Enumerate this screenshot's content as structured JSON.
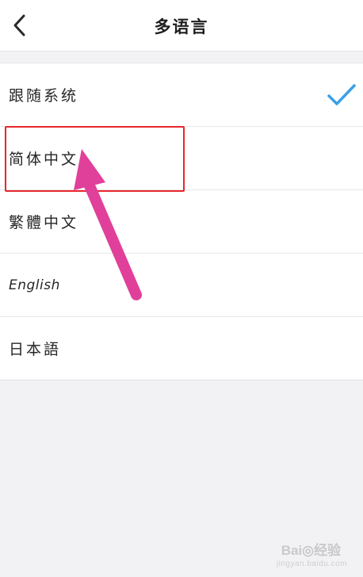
{
  "header": {
    "title": "多语言",
    "back_icon": "chevron-left-icon"
  },
  "languages": [
    {
      "label": "跟随系统",
      "selected": true
    },
    {
      "label": "简体中文",
      "selected": false
    },
    {
      "label": "繁體中文",
      "selected": false
    },
    {
      "label": "English",
      "selected": false
    },
    {
      "label": "日本語",
      "selected": false
    }
  ],
  "annotation": {
    "box_color": "#e8262c",
    "arrow_color": "#e0409a"
  },
  "colors": {
    "check": "#3aa0e6",
    "background": "#f2f2f4"
  },
  "watermark": {
    "text": "Bai◎经验",
    "sub": "jingyan.baidu.com"
  }
}
